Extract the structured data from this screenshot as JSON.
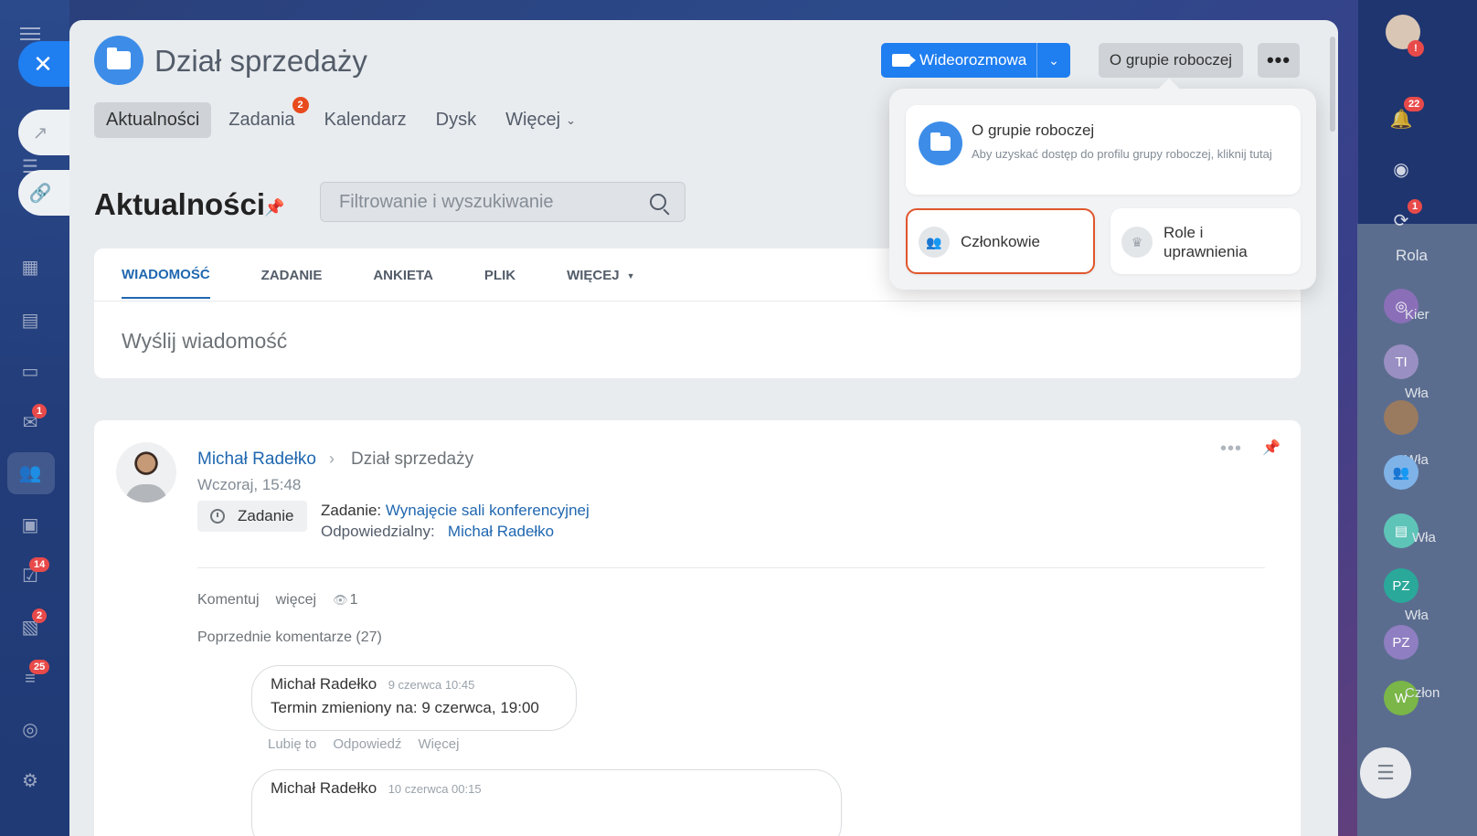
{
  "group": {
    "title": "Dział sprzedaży",
    "video_button": "Wideorozmowa",
    "about_button": "O grupie roboczej",
    "more_button": "•••"
  },
  "tabs": [
    {
      "label": "Aktualności",
      "active": true
    },
    {
      "label": "Zadania",
      "badge": "2"
    },
    {
      "label": "Kalendarz"
    },
    {
      "label": "Dysk"
    },
    {
      "label": "Więcej"
    }
  ],
  "page": {
    "title": "Aktualności",
    "search_placeholder": "Filtrowanie i wyszukiwanie"
  },
  "composer": {
    "tabs": [
      "WIADOMOŚĆ",
      "ZADANIE",
      "ANKIETA",
      "PLIK",
      "WIĘCEJ"
    ],
    "placeholder": "Wyślij wiadomość"
  },
  "post": {
    "author": "Michał Radełko",
    "group": "Dział sprzedaży",
    "time": "Wczoraj, 15:48",
    "chip": "Zadanie",
    "task_prefix": "Zadanie:",
    "task_link": "Wynajęcie sali konferencyjnej",
    "responsible_prefix": "Odpowiedzialny:",
    "responsible": "Michał Radełko",
    "actions": {
      "comment": "Komentuj",
      "more": "więcej",
      "views": "1"
    },
    "previous_comments": "Poprzednie komentarze (27)",
    "comments": [
      {
        "author": "Michał Radełko",
        "time": "9 czerwca 10:45",
        "text": "Termin zmieniony na: 9 czerwca, 19:00",
        "actions": [
          "Lubię to",
          "Odpowiedź",
          "Więcej"
        ]
      },
      {
        "author": "Michał Radełko",
        "time": "10 czerwca 00:15",
        "text": ""
      }
    ]
  },
  "popup": {
    "about_title": "O grupie roboczej",
    "about_desc": "Aby uzyskać dostęp do profilu grupy roboczej, kliknij tutaj",
    "members": "Członkowie",
    "roles": "Role i uprawnienia"
  },
  "left_rail": {
    "badges": {
      "mail": "1",
      "tasks": "14",
      "crm": "2",
      "funnel": "25"
    }
  },
  "right_rail": {
    "badges": {
      "notifications": "22",
      "sync": "1"
    },
    "avatars": [
      "TI",
      "PZ",
      "PZ",
      "W"
    ],
    "labels": [
      "Rola",
      "Kier",
      "Wła",
      "Wła",
      "Wła",
      "Wła",
      "Człon"
    ]
  },
  "colors": {
    "accent": "#1f7ef0",
    "link": "#2067b0",
    "badge": "#e84a1e",
    "highlight": "#e0562c"
  }
}
